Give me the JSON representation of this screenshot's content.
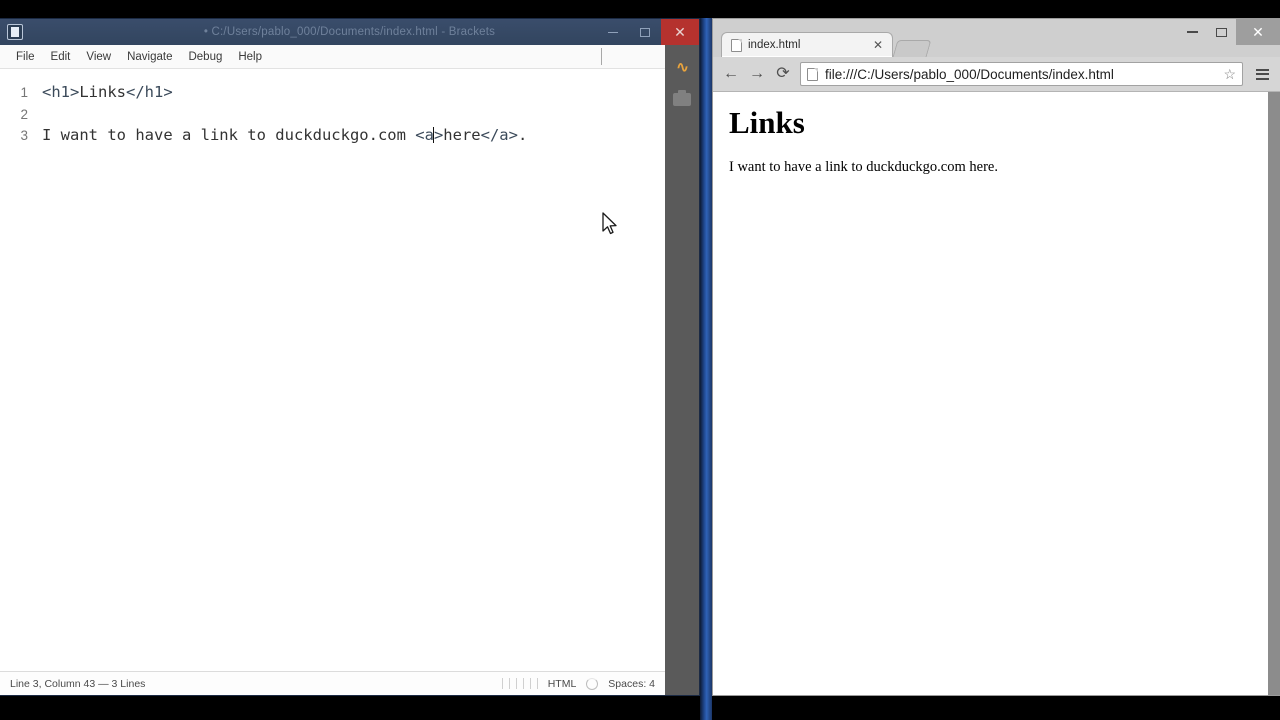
{
  "brackets": {
    "window_title": "• C:/Users/pablo_000/Documents/index.html - Brackets",
    "app_icon": "brackets-icon",
    "window_controls": {
      "minimize": "–",
      "maximize": "□",
      "close": "✕"
    },
    "menu": [
      "File",
      "Edit",
      "View",
      "Navigate",
      "Debug",
      "Help"
    ],
    "editor": {
      "lines": [
        {
          "number": "1",
          "segments": [
            {
              "text": "<h1>",
              "type": "tag"
            },
            {
              "text": "Links",
              "type": "text"
            },
            {
              "text": "</h1>",
              "type": "tag"
            }
          ]
        },
        {
          "number": "2",
          "segments": []
        },
        {
          "number": "3",
          "segments": [
            {
              "text": "I want to have a link to duckduckgo.com ",
              "type": "text"
            },
            {
              "text": "<a",
              "type": "tag"
            },
            {
              "text": "|",
              "type": "caret"
            },
            {
              "text": ">",
              "type": "tag"
            },
            {
              "text": "here",
              "type": "text"
            },
            {
              "text": "</a>",
              "type": "tag"
            },
            {
              "text": ".",
              "type": "text"
            }
          ]
        }
      ],
      "full_line_1": "<h1>Links</h1>",
      "full_line_3": "I want to have a link to duckduckgo.com <a>here</a>."
    },
    "statusbar": {
      "cursor_info": "Line 3, Column 43 — 3 Lines",
      "language": "HTML",
      "indent": "Spaces: 4"
    },
    "rightbar": {
      "live_preview": "lightning-bolt-icon",
      "extension_manager": "extension-manager-icon"
    }
  },
  "chrome": {
    "window_controls": {
      "minimize": "–",
      "maximize": "□",
      "close": "✕"
    },
    "tab": {
      "title": "index.html",
      "close": "✕"
    },
    "toolbar": {
      "back": "←",
      "forward": "→",
      "reload": "⟳",
      "url": "file:///C:/Users/pablo_000/Documents/index.html",
      "bookmark_star": "☆",
      "menu": "hamburger-menu-icon"
    },
    "page": {
      "heading": "Links",
      "paragraph": "I want to have a link to duckduckgo.com here."
    }
  },
  "colors": {
    "brackets_titlebar": "#32455f",
    "brackets_close": "#b5322e",
    "editor_bg": "#ffffff",
    "rightbar_bg": "#5a5a5a",
    "live_preview_accent": "#e8a33d",
    "chrome_toolbar": "#d6d6d6",
    "separator_blue": "#2f63b8"
  }
}
